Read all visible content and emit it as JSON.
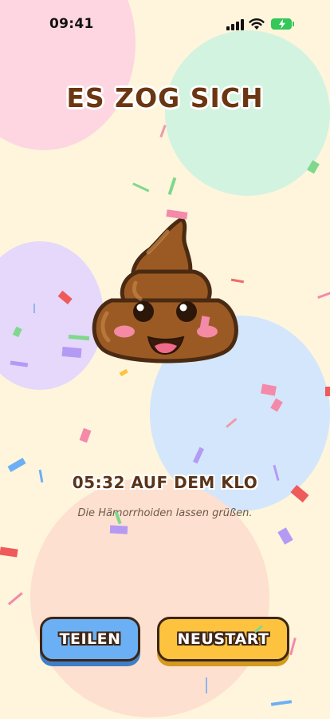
{
  "status_bar": {
    "time": "09:41"
  },
  "result": {
    "title": "ES ZOG SICH",
    "time_on_toilet": "05:32 AUF DEM KLO",
    "quip": "Die Hämorrhoiden lassen grüßen."
  },
  "buttons": {
    "share_label": "TEILEN",
    "restart_label": "NEUSTART"
  },
  "colors": {
    "background": "#fef5dc",
    "title": "#6b3612",
    "share_button": "#6bb0f4",
    "restart_button": "#fdc33f",
    "poop": "#9b5a24"
  },
  "icons": [
    "signal-icon",
    "wifi-icon",
    "battery-charging-icon",
    "poop-emoji-icon"
  ]
}
